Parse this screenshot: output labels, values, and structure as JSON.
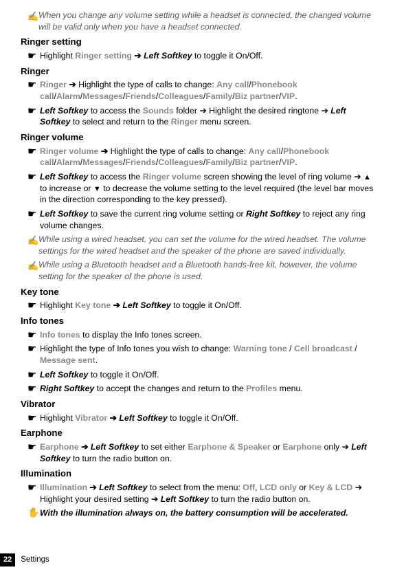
{
  "note1": "When you change any volume setting while a headset is connected, the changed volume will be valid only when you have a headset connected.",
  "ringer_setting": {
    "heading": "Ringer setting",
    "b1_pre": "Highlight ",
    "b1_gray": "Ringer setting",
    "b1_arrow": " ➔ ",
    "b1_bi": "Left Softkey",
    "b1_post": " to toggle it On/Off."
  },
  "ringer": {
    "heading": "Ringer",
    "b1_g1": "Ringer",
    "b1_arrow": " ➔ ",
    "b1_t1": "Highlight the type of calls to change: ",
    "b1_g2": "Any call",
    "b1_s1": "/",
    "b1_g3": "Phonebook call",
    "b1_s2": "/",
    "b1_g4": "Alarm",
    "b1_s3": "/",
    "b1_g5": "Messages",
    "b1_s4": "/",
    "b1_g6": "Friends",
    "b1_s5": "/",
    "b1_g7": "Colleagues",
    "b1_s6": "/",
    "b1_g8": "Family",
    "b1_s7": "/",
    "b1_g9": "Biz partner",
    "b1_s8": "/",
    "b1_g10": "VIP",
    "b1_end": ".",
    "b2_bi1": "Left Softkey",
    "b2_t1": " to access the ",
    "b2_g1": "Sounds",
    "b2_t2": " folder ➔ Highlight the desired ringtone ➔ ",
    "b2_bi2": "Left Softkey",
    "b2_t3": " to select and return to the ",
    "b2_g2": "Ringer",
    "b2_t4": " menu screen."
  },
  "ringer_volume": {
    "heading": "Ringer volume",
    "b1_g1": "Ringer volume",
    "b1_arrow": " ➔ ",
    "b1_t1": "Highlight the type of calls to change: ",
    "b1_g2": "Any call",
    "b1_s1": "/",
    "b1_g3": "Phonebook call",
    "b1_s2": "/",
    "b1_g4": "Alarm",
    "b1_s3": "/",
    "b1_g5": "Messages",
    "b1_s4": "/",
    "b1_g6": "Friends",
    "b1_s5": "/",
    "b1_g7": "Colleagues",
    "b1_s6": "/",
    "b1_g8": "Family",
    "b1_s7": "/",
    "b1_g9": "Biz partner",
    "b1_s8": "/",
    "b1_g10": "VIP",
    "b1_end": ".",
    "b2_bi1": "Left Softkey",
    "b2_t1": " to access the ",
    "b2_g1": "Ringer volume",
    "b2_t2": " screen showing the level of ring volume ➔ ",
    "b2_tri1": "▲",
    "b2_t3": " to increase or ",
    "b2_tri2": "▼",
    "b2_t4": " to decrease the volume setting to the level required (the level bar moves in the direction corresponding to the key pressed).",
    "b3_bi1": "Left Softkey",
    "b3_t1": " to save the current ring volume setting or ",
    "b3_bi2": "Right Softkey",
    "b3_t2": " to reject any ring volume changes.",
    "note1": "While using a wired headset, you can set the volume for the wired headset. The volume settings for the wired headset and the speaker of the phone are saved individually.",
    "note2": "While using a Bluetooth headset and a Bluetooth hands-free kit, however, the volume setting for the speaker of the phone is used."
  },
  "key_tone": {
    "heading": "Key tone",
    "b1_pre": "Highlight ",
    "b1_g": "Key tone",
    "b1_arrow": " ➔ ",
    "b1_bi": "Left Softkey",
    "b1_post": " to toggle it On/Off."
  },
  "info_tones": {
    "heading": "Info tones",
    "b1_g": "Info tones",
    "b1_t": " to display the Info tones screen.",
    "b2_t1": "Highlight the type of Info tones you wish to change: ",
    "b2_g1": "Warning tone",
    "b2_s1": " / ",
    "b2_g2": "Cell broadcast",
    "b2_s2": " / ",
    "b2_g3": "Message sent",
    "b2_end": ".",
    "b3_bi": "Left Softkey",
    "b3_t": " to toggle it On/Off.",
    "b4_bi": "Right Softkey",
    "b4_t1": " to accept the changes and return to the ",
    "b4_g": "Profiles",
    "b4_t2": " menu."
  },
  "vibrator": {
    "heading": "Vibrator",
    "b1_pre": "Highlight ",
    "b1_g": "Vibrator",
    "b1_arrow": " ➔ ",
    "b1_bi": "Left Softkey",
    "b1_post": " to toggle it On/Off."
  },
  "earphone": {
    "heading": "Earphone",
    "b1_g1": "Earphone",
    "b1_arrow1": " ➔ ",
    "b1_bi1": "Left Softkey",
    "b1_t1": " to set either ",
    "b1_g2": "Earphone & Speaker",
    "b1_t2": " or ",
    "b1_g3": "Earphone",
    "b1_t3": " only ➔ ",
    "b1_bi2": "Left Softkey",
    "b1_t4": " to turn the radio button on."
  },
  "illumination": {
    "heading": "Illumination",
    "b1_g1": "Illumination",
    "b1_arrow1": " ➔ ",
    "b1_bi1": "Left Softkey",
    "b1_t1": " to select from the menu: ",
    "b1_g2": "Off",
    "b1_s1": ", ",
    "b1_g3": "LCD only",
    "b1_t2": " or ",
    "b1_g4": "Key & LCD",
    "b1_t3": " ➔ Highlight your desired setting ➔ ",
    "b1_bi2": "Left Softkey",
    "b1_t4": " to turn the radio button on.",
    "hand": "With the illumination always on, the battery consumption will be accelerated."
  },
  "footer": {
    "page": "22",
    "label": "Settings"
  }
}
